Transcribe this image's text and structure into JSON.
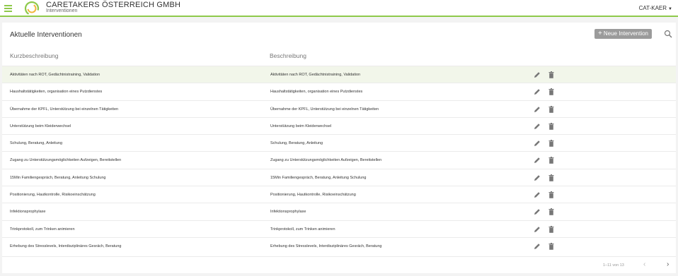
{
  "header": {
    "company": "CARETAKERS ÖSTERREICH GMBH",
    "subtitle": "Interventionen",
    "user": "CAT-KAER",
    "brand_color": "#8ec94a"
  },
  "card": {
    "title": "Aktuelle Interventionen",
    "add_label": "Neue Intervention"
  },
  "table": {
    "columns": [
      "Kurzbeschreibung",
      "Beschreibung"
    ],
    "rows": [
      {
        "short": "Aktivitäten nach ROT, Gedächtnistraining, Validation",
        "desc": "Aktivitäten nach ROT, Gedächtnistraining, Validation"
      },
      {
        "short": "Haushaltstätigkeiten, organisation eines Putzdienstes",
        "desc": "Haushaltstätigkeiten, organisation eines Putzdienstes"
      },
      {
        "short": "Übernahme der KPFL, Unterstützung bei einzelnen Tätigkeiten",
        "desc": "Übernahme der KPFL, Unterstützung bei einzelnen Tätigkeiten"
      },
      {
        "short": "Unterstützung beim Kleiderwechsel",
        "desc": "Unterstützung beim Kleiderwechsel"
      },
      {
        "short": "Schulung, Beratung, Anleitung",
        "desc": "Schulung, Beratung, Anleitung"
      },
      {
        "short": "Zugang zu Unterstützungsmöglichkeiten Aufzeigen, Bereitstellen",
        "desc": "Zugang zu Unterstützungsmöglichkeiten Aufzeigen, Bereitstellen"
      },
      {
        "short": "15Min Familiengespräch, Beratung, Anleitung Schulung",
        "desc": "15Min Familiengespräch, Beratung, Anleitung Schulung"
      },
      {
        "short": "Positionierung, Hautkontrolle, Risikoeinschätzung",
        "desc": "Positionierung, Hautkontrolle, Risikoeinschätzung"
      },
      {
        "short": "Infektionsprophylaxe",
        "desc": "Infektionsprophylaxe"
      },
      {
        "short": "Trinkprotokoll, zum Trinken animieren",
        "desc": "Trinkprotokoll, zum Trinken animieren"
      },
      {
        "short": "Erhebung des Stresslevels, Interdisziplinäres Gesräch, Beratung",
        "desc": "Erhebung des Stresslevels, Interdisziplinäres Gesräch, Beratung"
      }
    ]
  },
  "pagination": {
    "info": "1–11 von 13"
  },
  "icons": {
    "menu": "menu-icon",
    "search": "search-icon",
    "edit": "pencil-icon",
    "delete": "trash-icon"
  }
}
